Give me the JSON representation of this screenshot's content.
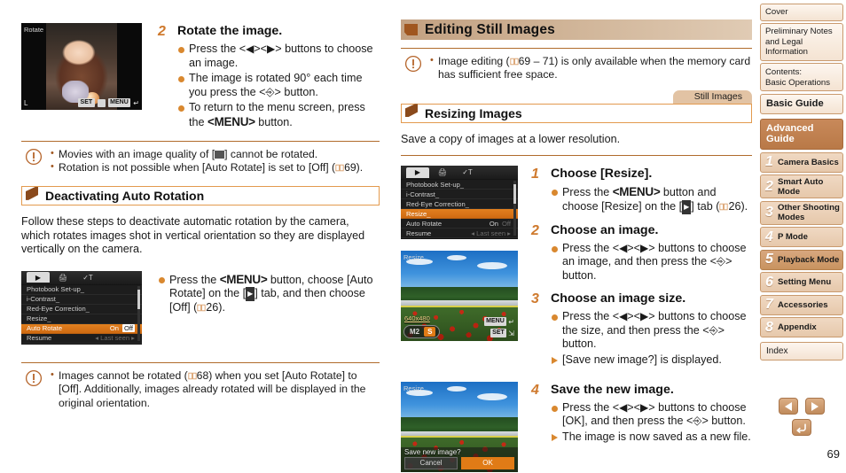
{
  "page": {
    "number": "69"
  },
  "left_column": {
    "rotate_screen": {
      "title_label": "Rotate",
      "quality_label": "L",
      "hint_set": "SET",
      "hint_menu": "MENU"
    },
    "step2": {
      "number": "2",
      "title": "Rotate the image.",
      "bullets": [
        "Press the <◀><▶> buttons to choose an image.",
        "The image is rotated 90° each time you press the <FUNC SET> button.",
        "To return to the menu screen, press the <MENU> button."
      ]
    },
    "note1": {
      "items": [
        "Movies with an image quality of [ ] cannot be rotated.",
        "Rotation is not possible when [Auto Rotate] is set to [Off] ( 69)."
      ]
    },
    "heading_deactivating": "Deactivating Auto Rotation",
    "intro_paragraph": "Follow these steps to deactivate automatic rotation by the camera, which rotates images shot in vertical orientation so they are displayed vertically on the camera.",
    "menu_screen": {
      "tabs": [
        "playback-tab",
        "print-tab",
        "settings-tab"
      ],
      "rows": [
        {
          "label": "Photobook Set-up_",
          "value": ""
        },
        {
          "label": "i-Contrast_",
          "value": ""
        },
        {
          "label": "Red-Eye Correction_",
          "value": ""
        },
        {
          "label": "Resize_",
          "value": ""
        },
        {
          "label": "Auto Rotate",
          "value": "On",
          "value2": "Off",
          "selected": true
        },
        {
          "label": "Resume",
          "value": "◂ Last seen ▸"
        }
      ]
    },
    "menu_bullet": "Press the <MENU> button, choose [Auto Rotate] on the [▶] tab, and then choose [Off] ( 26).",
    "note2": {
      "items": [
        "Images cannot be rotated ( 68) when you set [Auto Rotate] to [Off]. Additionally, images already rotated will be displayed in the original orientation."
      ]
    }
  },
  "right_column": {
    "heading_editing": "Editing Still Images",
    "note1": {
      "items": [
        "Image editing ( 69 – 71) is only available when the memory card has sufficient free space."
      ]
    },
    "tab_still_images": "Still Images",
    "heading_resizing": "Resizing Images",
    "intro_paragraph": "Save a copy of images at a lower resolution.",
    "menu_screen": {
      "rows": [
        {
          "label": "Photobook Set-up_",
          "value": ""
        },
        {
          "label": "i-Contrast_",
          "value": ""
        },
        {
          "label": "Red-Eye Correction_",
          "value": ""
        },
        {
          "label": "Resize_",
          "value": "",
          "selected": true
        },
        {
          "label": "Auto Rotate",
          "value": "On",
          "value2": "Off"
        },
        {
          "label": "Resume",
          "value": "◂ Last seen ▸"
        }
      ]
    },
    "resize_screen": {
      "title_label": "Resize",
      "resolution": "640x480",
      "sizes": [
        "M2",
        "S"
      ],
      "selected_size": "S",
      "hint_menu": "MENU",
      "hint_set": "SET"
    },
    "save_screen": {
      "title_label": "Resize",
      "prompt": "Save new image?",
      "cancel": "Cancel",
      "ok": "OK"
    },
    "step1": {
      "number": "1",
      "title": "Choose [Resize].",
      "bullets": [
        "Press the <MENU> button and choose [Resize] on the [▶] tab ( 26)."
      ]
    },
    "step2": {
      "number": "2",
      "title": "Choose an image.",
      "bullets": [
        "Press the <◀><▶> buttons to choose an image, and then press the <FUNC SET> button."
      ]
    },
    "step3": {
      "number": "3",
      "title": "Choose an image size.",
      "bullets": [
        "Press the <◀><▶> buttons to choose the size, and then press the <FUNC SET> button."
      ],
      "result": "[Save new image?] is displayed."
    },
    "step4": {
      "number": "4",
      "title": "Save the new image.",
      "bullets": [
        "Press the <◀><▶> buttons to choose [OK], and then press the <FUNC SET> button."
      ],
      "result": "The image is now saved as a new file."
    }
  },
  "sidebar": {
    "top_items": [
      {
        "label": "Cover",
        "style": "plain"
      },
      {
        "label": "Preliminary Notes and Legal Information",
        "style": "plain"
      },
      {
        "label": "Contents:\nBasic Operations",
        "style": "plain"
      },
      {
        "label": "Basic Guide",
        "style": "big"
      },
      {
        "label": "Advanced Guide",
        "style": "adv"
      }
    ],
    "cover_label": "Cover",
    "prelim_label": "Preliminary Notes and Legal Information",
    "contents_label_1": "Contents:",
    "contents_label_2": "Basic Operations",
    "basic_guide_label": "Basic Guide",
    "advanced_guide_label": "Advanced Guide",
    "chapters": [
      {
        "num": "1",
        "label": "Camera Basics",
        "active": false
      },
      {
        "num": "2",
        "label": "Smart Auto\nMode",
        "active": false
      },
      {
        "num": "3",
        "label": "Other Shooting\nModes",
        "active": false
      },
      {
        "num": "4",
        "label": "P Mode",
        "active": false
      },
      {
        "num": "5",
        "label": "Playback Mode",
        "active": true
      },
      {
        "num": "6",
        "label": "Setting Menu",
        "active": false
      },
      {
        "num": "7",
        "label": "Accessories",
        "active": false
      },
      {
        "num": "8",
        "label": "Appendix",
        "active": false
      }
    ],
    "index_label": "Index",
    "nav": {
      "prev": "previous-page",
      "next": "next-page",
      "back": "go-back"
    }
  },
  "colors": {
    "accent_orange": "#cf7a2e",
    "header_tan": "#cfb396",
    "rule_brown": "#b06b2c",
    "selection_orange": "#e07b16",
    "sidebar_active": "#c8935f"
  }
}
